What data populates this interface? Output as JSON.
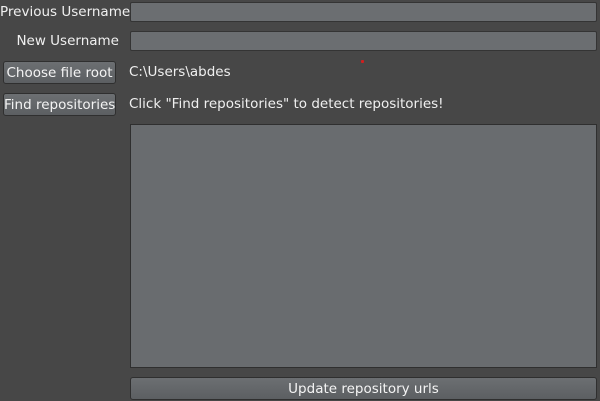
{
  "form": {
    "previous_username": {
      "label": "Previous Username",
      "value": ""
    },
    "new_username": {
      "label": "New Username",
      "value": ""
    }
  },
  "file_root": {
    "button_label": "Choose file root",
    "path": "C:\\Users\\abdes"
  },
  "repositories": {
    "button_label": "Find repositories",
    "status": "Click \"Find repositories\" to detect repositories!",
    "items": []
  },
  "actions": {
    "update_label": "Update repository urls"
  },
  "colors": {
    "background": "#474747",
    "field": "#6b6e71",
    "text": "#f0f0f0",
    "marker": "#d21e1e"
  }
}
